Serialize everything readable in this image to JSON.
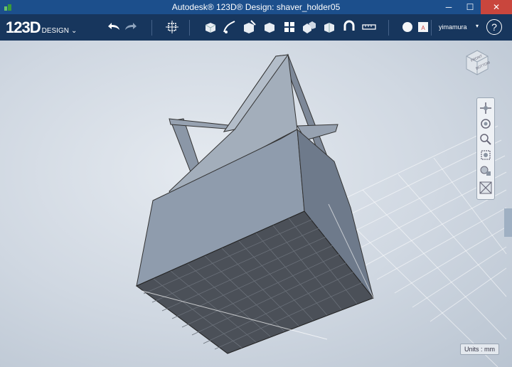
{
  "window": {
    "title": "Autodesk® 123D® Design: shaver_holder05",
    "minimize": "─",
    "maximize": "☐",
    "close": "✕"
  },
  "logo": {
    "main": "123D",
    "sub": "DESIGN",
    "chevron": "⌄"
  },
  "toolbar": {
    "undo_icon": "undo-icon",
    "redo_icon": "redo-icon",
    "tools": [
      "transform-icon",
      "primitives-icon",
      "sketch-icon",
      "construct-icon",
      "modify-icon",
      "pattern-icon",
      "grouping-icon",
      "combine-icon",
      "snap-icon",
      "measure-icon",
      "material-icon",
      "text-icon"
    ]
  },
  "user": {
    "name": "yimamura",
    "chevron": "▾"
  },
  "help": {
    "label": "?"
  },
  "viewcube": {
    "front": "FRONT",
    "bottom": "BOTTOM"
  },
  "units": {
    "label": "Units : mm"
  },
  "colors": {
    "toolbar": "#17365d",
    "titlebar": "#1c4f8c",
    "model_face": "#8d9aab",
    "model_dark": "#4a4f57",
    "grid": "#ffffff"
  }
}
